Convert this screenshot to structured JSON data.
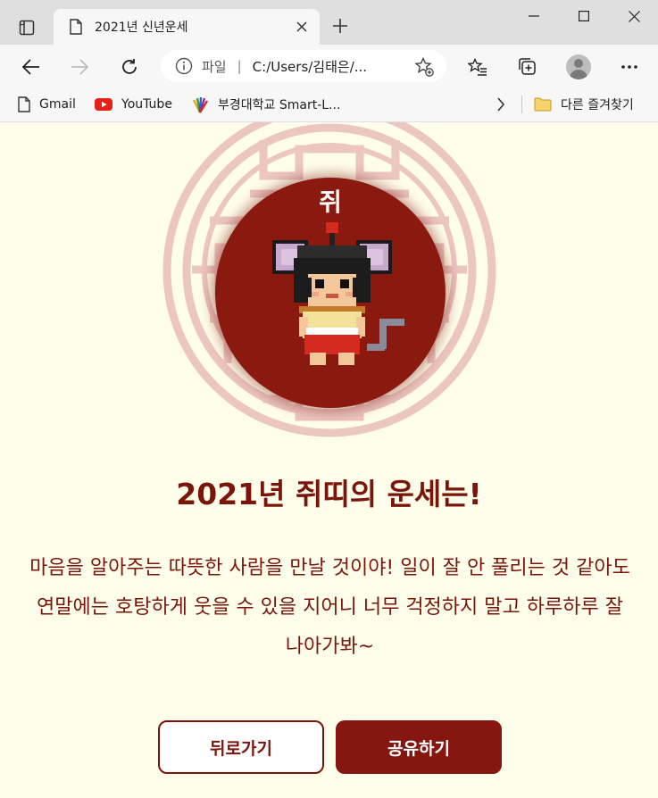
{
  "browser": {
    "tab_title": "2021년 신년운세",
    "address_prefix": "파일",
    "address_sep": "|",
    "address_url": "C:/Users/김태은/...",
    "bookmarks": [
      {
        "label": "Gmail",
        "icon": "page-icon"
      },
      {
        "label": "YouTube",
        "icon": "youtube-icon"
      },
      {
        "label": "부경대학교 Smart-L...",
        "icon": "school-icon"
      }
    ],
    "other_favorites": "다른 즐겨찾기",
    "accent_tab_bg": "#f7f7f7",
    "tabstrip_bg": "#dfdfdf"
  },
  "page": {
    "zodiac_name": "쥐",
    "heading": "2021년 쥐띠의 운세는!",
    "fortune_text": "마음을 알아주는 따뜻한 사람을 만날 것이야! 일이 잘 안 풀리는 것 같아도 연말에는 호탕하게 웃을 수 있을 지어니 너무 걱정하지 말고 하루하루 잘 나아가봐~",
    "back_button": "뒤로가기",
    "share_button": "공유하기",
    "colors": {
      "background": "#fffeea",
      "primary": "#851710",
      "text": "#7a150c",
      "seal": "#e9c3bd"
    },
    "mascot": "rat-mascot-icon"
  }
}
